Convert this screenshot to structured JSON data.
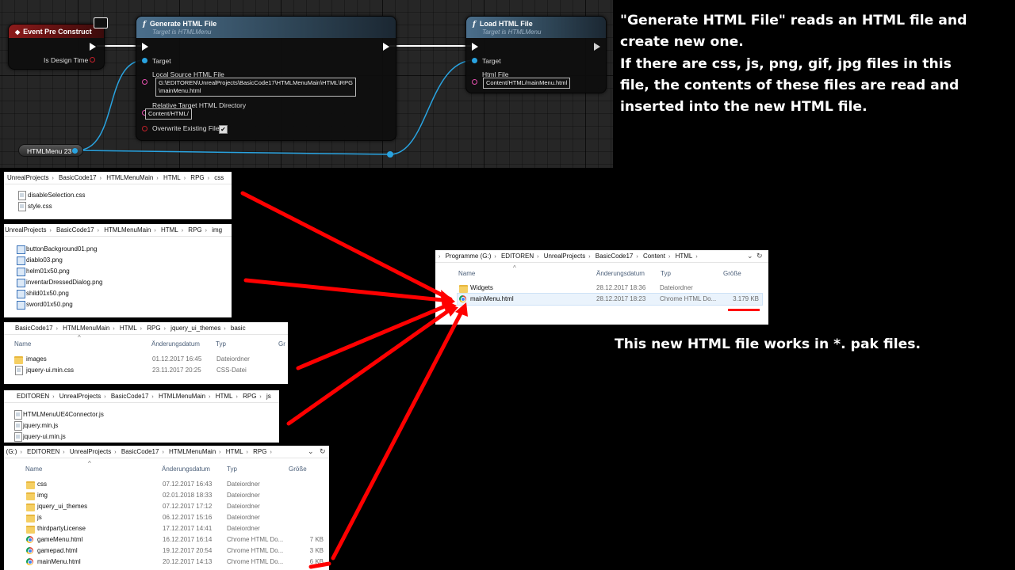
{
  "blueprint": {
    "event_node": {
      "title": "Event Pre Construct",
      "pin_is_design_time": "Is Design Time"
    },
    "generate_node": {
      "title": "Generate HTML File",
      "subtitle": "Target is HTMLMenu",
      "pin_target": "Target",
      "pin_source": "Local Source HTML File",
      "source_line1": "G:\\EDITOREN\\UnrealProjects\\BasicCode17\\HTMLMenuMain\\HTML\\RPG",
      "source_line2": "\\mainMenu.html",
      "pin_target_dir": "Relative Target HTML Directory",
      "target_dir_value": "Content/HTML/",
      "pin_overwrite": "Overwrite Existing File",
      "overwrite_checked": true
    },
    "load_node": {
      "title": "Load HTML File",
      "subtitle": "Target is HTMLMenu",
      "pin_target": "Target",
      "pin_html_file": "Html File",
      "html_file_value": "Content/HTML/mainMenu.html"
    },
    "variable_node": {
      "label": "HTMLMenu 23"
    }
  },
  "description": {
    "lines": [
      "\"Generate HTML File\" reads an HTML file and",
      "create new one.",
      "If there are css, js, png, gif, jpg files in this",
      "file, the contents of these files are read and",
      "inserted into the new HTML file."
    ],
    "pak_note": "This new HTML file works in *. pak files."
  },
  "panels": {
    "css": {
      "breadcrumb": [
        "UnrealProjects",
        "BasicCode17",
        "HTMLMenuMain",
        "HTML",
        "RPG",
        "css"
      ],
      "files": [
        "disableSelection.css",
        "style.css"
      ]
    },
    "img": {
      "breadcrumb": [
        "UnrealProjects",
        "BasicCode17",
        "HTMLMenuMain",
        "HTML",
        "RPG",
        "img"
      ],
      "files": [
        "buttonBackground01.png",
        "diablo03.png",
        "helm01x50.png",
        "inventarDressedDialog.png",
        "shild01x50.png",
        "sword01x50.png"
      ]
    },
    "themes": {
      "breadcrumb": [
        "BasicCode17",
        "HTMLMenuMain",
        "HTML",
        "RPG",
        "jquery_ui_themes",
        "basic"
      ],
      "columns": {
        "name": "Name",
        "date": "Änderungsdatum",
        "type": "Typ",
        "size": "Gr"
      },
      "rows": [
        {
          "name": "images",
          "date": "01.12.2017 16:45",
          "type": "Dateiordner"
        },
        {
          "name": "jquery-ui.min.css",
          "date": "23.11.2017 20:25",
          "type": "CSS-Datei"
        }
      ]
    },
    "js": {
      "breadcrumb": [
        "EDITOREN",
        "UnrealProjects",
        "BasicCode17",
        "HTMLMenuMain",
        "HTML",
        "RPG",
        "js"
      ],
      "files": [
        "HTMLMenuUE4Connector.js",
        "jquery.min.js",
        "jquery-ui.min.js"
      ]
    },
    "rpg": {
      "breadcrumb": [
        "e (G:)",
        "EDITOREN",
        "UnrealProjects",
        "BasicCode17",
        "HTMLMenuMain",
        "HTML",
        "RPG"
      ],
      "columns": {
        "name": "Name",
        "date": "Änderungsdatum",
        "type": "Typ",
        "size": "Größe"
      },
      "rows": [
        {
          "name": "css",
          "date": "07.12.2017 16:43",
          "type": "Dateiordner",
          "size": ""
        },
        {
          "name": "img",
          "date": "02.01.2018 18:33",
          "type": "Dateiordner",
          "size": ""
        },
        {
          "name": "jquery_ui_themes",
          "date": "07.12.2017 17:12",
          "type": "Dateiordner",
          "size": ""
        },
        {
          "name": "js",
          "date": "06.12.2017 15:16",
          "type": "Dateiordner",
          "size": ""
        },
        {
          "name": "thirdpartyLicense",
          "date": "17.12.2017 14:41",
          "type": "Dateiordner",
          "size": ""
        },
        {
          "name": "gameMenu.html",
          "date": "16.12.2017 16:14",
          "type": "Chrome HTML Do...",
          "size": "7 KB"
        },
        {
          "name": "gamepad.html",
          "date": "19.12.2017 20:54",
          "type": "Chrome HTML Do...",
          "size": "3 KB"
        },
        {
          "name": "mainMenu.html",
          "date": "20.12.2017 14:13",
          "type": "Chrome HTML Do...",
          "size": "6 KB"
        }
      ]
    },
    "content": {
      "breadcrumb": [
        "Programme (G:)",
        "EDITOREN",
        "UnrealProjects",
        "BasicCode17",
        "Content",
        "HTML"
      ],
      "columns": {
        "name": "Name",
        "date": "Änderungsdatum",
        "type": "Typ",
        "size": "Größe"
      },
      "rows": [
        {
          "name": "Widgets",
          "date": "28.12.2017 18:36",
          "type": "Dateiordner",
          "size": ""
        },
        {
          "name": "mainMenu.html",
          "date": "28.12.2017 18:23",
          "type": "Chrome HTML Do...",
          "size": "3.179 KB"
        }
      ]
    }
  },
  "colors": {
    "arrow": "#ff0000",
    "fn_header": "#3c5a72",
    "event_header": "#7a1616",
    "pin_object": "#29a3e0",
    "pin_string": "#e44fae"
  }
}
